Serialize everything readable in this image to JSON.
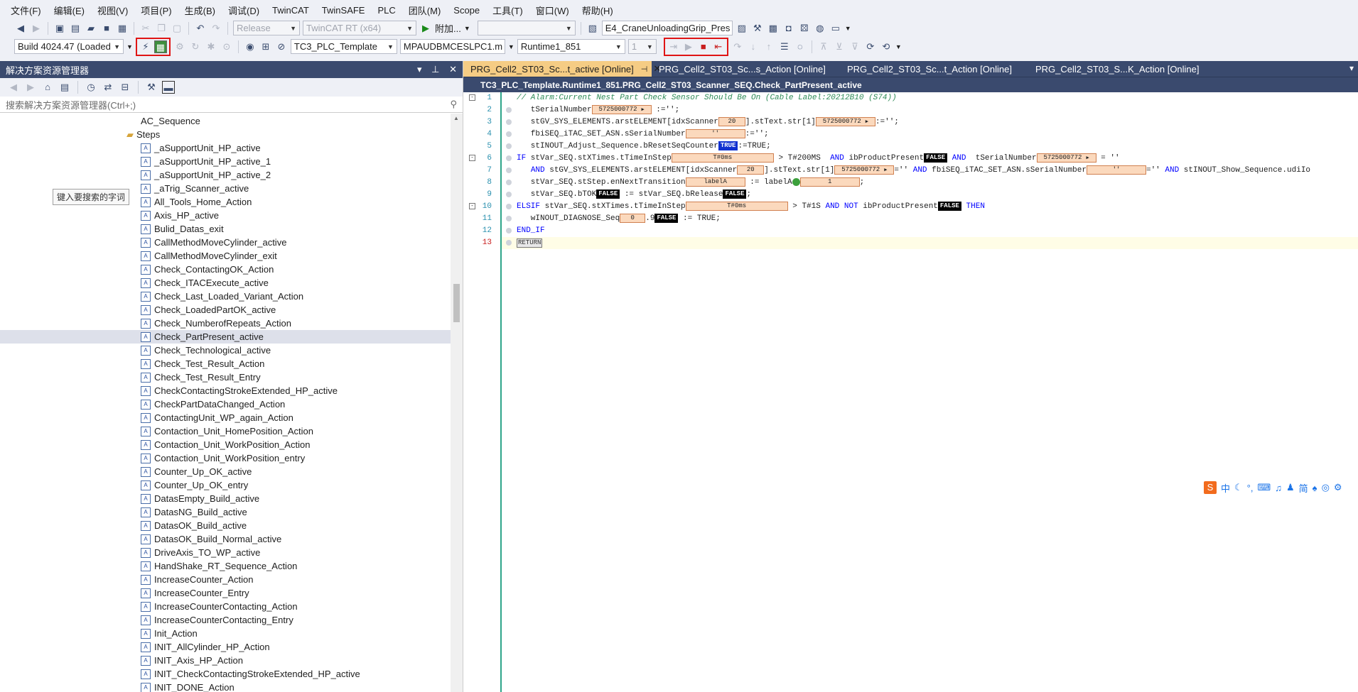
{
  "menu": [
    "文件(F)",
    "编辑(E)",
    "视图(V)",
    "项目(P)",
    "生成(B)",
    "调试(D)",
    "TwinCAT",
    "TwinSAFE",
    "PLC",
    "团队(M)",
    "Scope",
    "工具(T)",
    "窗口(W)",
    "帮助(H)"
  ],
  "toolbar1": {
    "config_combo": "Release",
    "platform_combo": "TwinCAT RT (x64)",
    "attach_label": "附加...",
    "project_combo": "E4_CraneUnloadingGrip_Pres"
  },
  "toolbar2": {
    "build_combo": "Build 4024.47 (Loaded",
    "plc_project_combo": "TC3_PLC_Template",
    "target_combo": "MPAUDBMCESLPC1.m",
    "runtime_combo": "Runtime1_851",
    "port_combo": "1"
  },
  "solution_explorer": {
    "title": "解决方案资源管理器",
    "search_placeholder": "搜索解决方案资源管理器(Ctrl+;)",
    "tooltip": "键入要搜索的字词",
    "top_items": [
      "AC_Sequence",
      "Steps"
    ],
    "items": [
      "_aSupportUnit_HP_active",
      "_aSupportUnit_HP_active_1",
      "_aSupportUnit_HP_active_2",
      "_aTrig_Scanner_active",
      "All_Tools_Home_Action",
      "Axis_HP_active",
      "Bulid_Datas_exit",
      "CallMethodMoveCylinder_active",
      "CallMethodMoveCylinder_exit",
      "Check_ContactingOK_Action",
      "Check_ITACExecute_active",
      "Check_Last_Loaded_Variant_Action",
      "Check_LoadedPartOK_active",
      "Check_NumberofRepeats_Action",
      "Check_PartPresent_active",
      "Check_Technological_active",
      "Check_Test_Result_Action",
      "Check_Test_Result_Entry",
      "CheckContactingStrokeExtended_HP_active",
      "CheckPartDataChanged_Action",
      "ContactingUnit_WP_again_Action",
      "Contaction_Unit_HomePosition_Action",
      "Contaction_Unit_WorkPosition_Action",
      "Contaction_Unit_WorkPosition_entry",
      "Counter_Up_OK_active",
      "Counter_Up_OK_entry",
      "DatasEmpty_Build_active",
      "DatasNG_Build_active",
      "DatasOK_Build_active",
      "DatasOK_Build_Normal_active",
      "DriveAxis_TO_WP_active",
      "HandShake_RT_Sequence_Action",
      "IncreaseCounter_Action",
      "IncreaseCounter_Entry",
      "IncreaseCounterContacting_Action",
      "IncreaseCounterContacting_Entry",
      "Init_Action",
      "INIT_AllCylinder_HP_Action",
      "INIT_Axis_HP_Action",
      "INIT_CheckContactingStrokeExtended_HP_active",
      "INIT_DONE_Action"
    ],
    "selected": "Check_PartPresent_active"
  },
  "tabs": [
    "PRG_Cell2_ST03_Sc...t_active [Online]",
    "PRG_Cell2_ST03_Sc...s_Action [Online]",
    "PRG_Cell2_ST03_Sc...t_Action [Online]",
    "PRG_Cell2_ST03_S...K_Action [Online]"
  ],
  "breadcrumb": "TC3_PLC_Template.Runtime1_851.PRG_Cell2_ST03_Scanner_SEQ.Check_PartPresent_active",
  "online_values": {
    "serial": "5725000772",
    "idx": "20",
    "empty": "''",
    "true": "TRUE",
    "false": "FALSE",
    "t0": "T#0ms",
    "label": "labelA",
    "one": "1",
    "zero": "0"
  },
  "code": {
    "l1": "// Alarm:Current Nest Part Check Sensor Should Be On (Cable Label:20212B10 (S74))",
    "l13": "RETURN"
  },
  "line_numbers": [
    "1",
    "2",
    "3",
    "4",
    "5",
    "6",
    "7",
    "8",
    "9",
    "10",
    "11",
    "12",
    "13"
  ],
  "ime_bar": [
    "中",
    "简"
  ]
}
